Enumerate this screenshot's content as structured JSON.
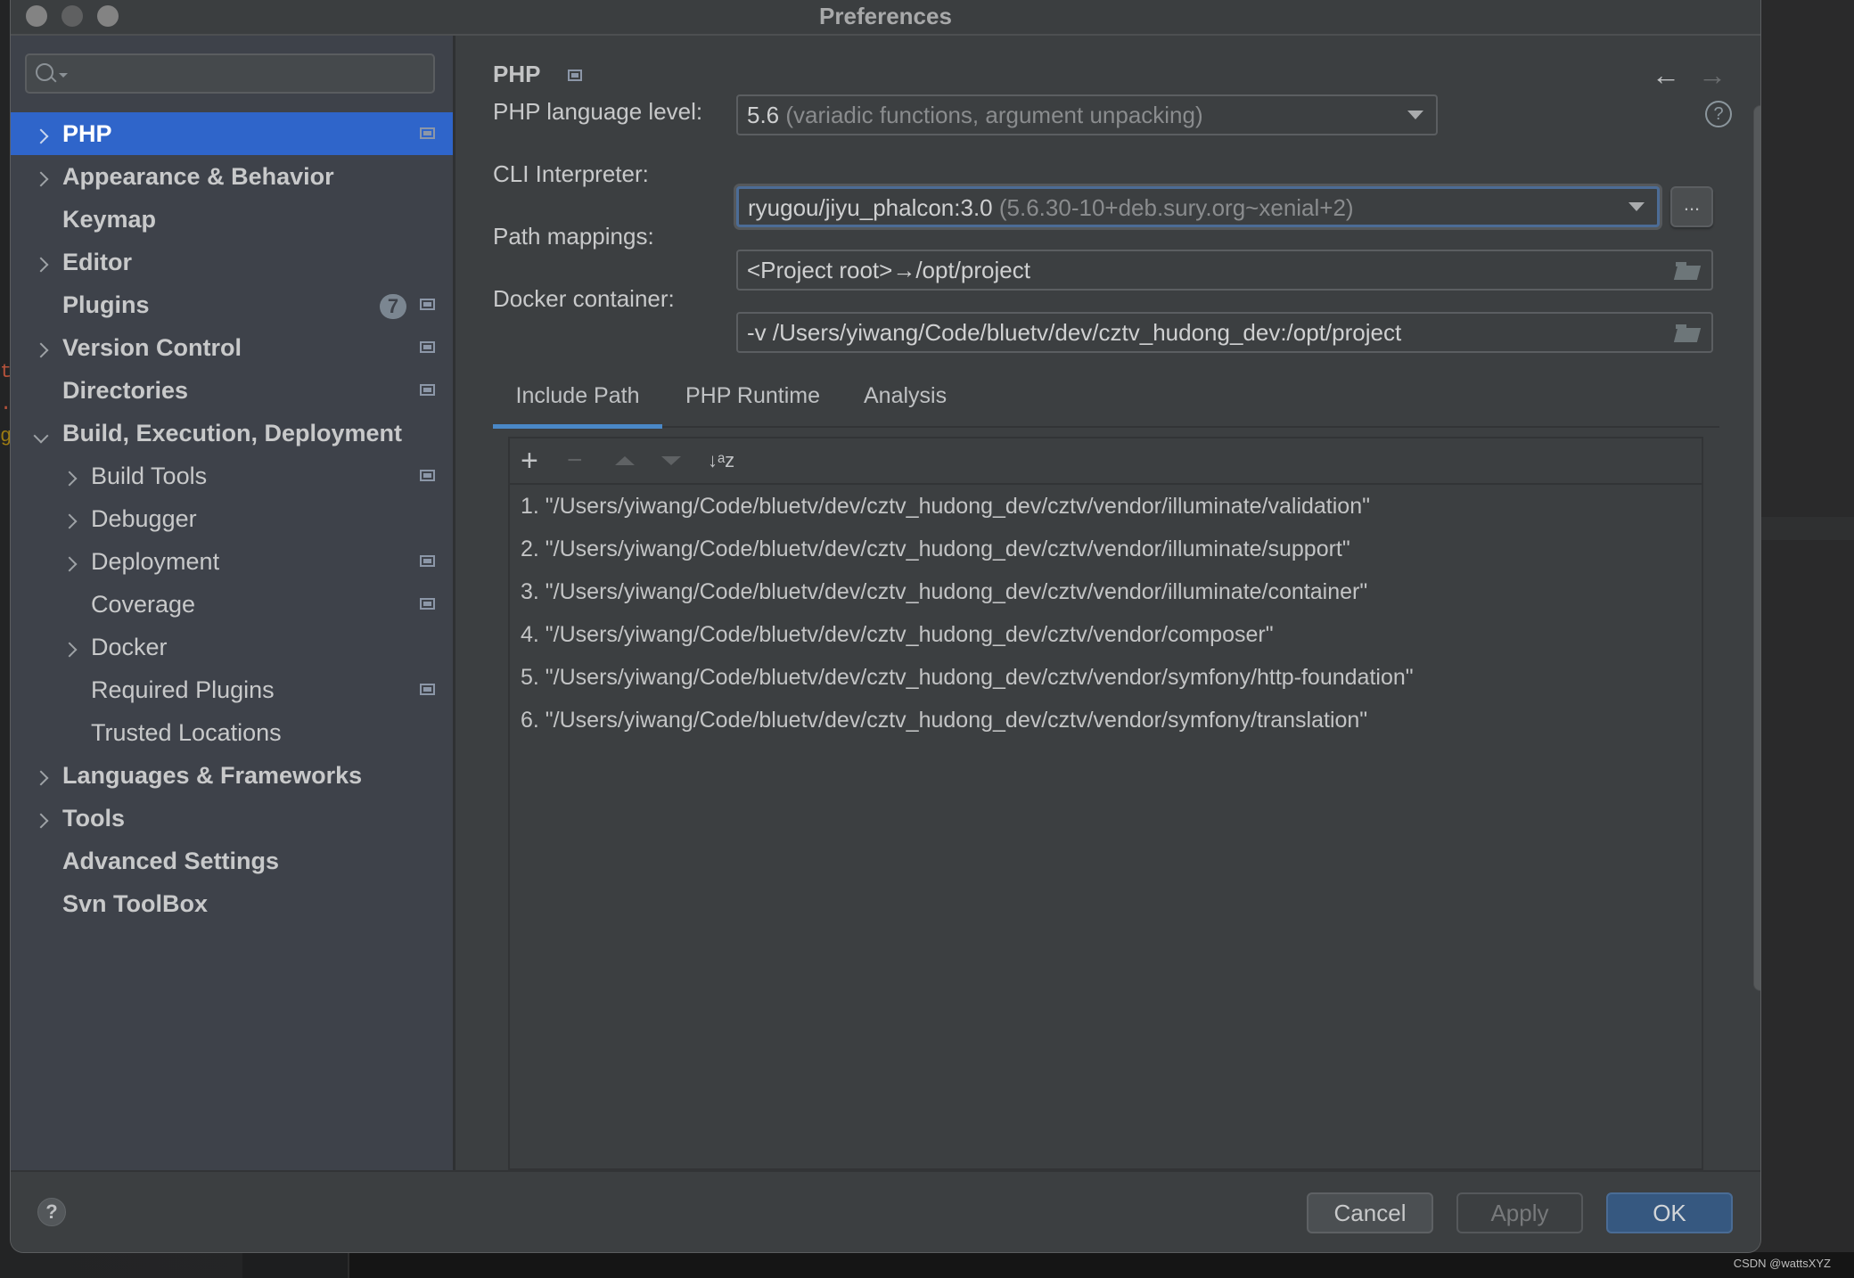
{
  "window": {
    "title": "Preferences"
  },
  "search": {
    "placeholder": "",
    "value": ""
  },
  "sidebar": {
    "items": [
      {
        "label": "PHP",
        "level": 0,
        "bold": true,
        "expander": "right",
        "selected": true,
        "project_icon": true
      },
      {
        "label": "Appearance & Behavior",
        "level": 0,
        "bold": true,
        "expander": "right"
      },
      {
        "label": "Keymap",
        "level": 0,
        "bold": true,
        "expander": "none"
      },
      {
        "label": "Editor",
        "level": 0,
        "bold": true,
        "expander": "right"
      },
      {
        "label": "Plugins",
        "level": 0,
        "bold": true,
        "expander": "none",
        "badge": "7",
        "project_icon": true
      },
      {
        "label": "Version Control",
        "level": 0,
        "bold": true,
        "expander": "right",
        "project_icon": true
      },
      {
        "label": "Directories",
        "level": 0,
        "bold": true,
        "expander": "none",
        "project_icon": true
      },
      {
        "label": "Build, Execution, Deployment",
        "level": 0,
        "bold": true,
        "expander": "down"
      },
      {
        "label": "Build Tools",
        "level": 1,
        "expander": "right",
        "project_icon": true
      },
      {
        "label": "Debugger",
        "level": 1,
        "expander": "right"
      },
      {
        "label": "Deployment",
        "level": 1,
        "expander": "right",
        "project_icon": true
      },
      {
        "label": "Coverage",
        "level": 1,
        "expander": "none",
        "project_icon": true
      },
      {
        "label": "Docker",
        "level": 1,
        "expander": "right"
      },
      {
        "label": "Required Plugins",
        "level": 1,
        "expander": "none",
        "project_icon": true
      },
      {
        "label": "Trusted Locations",
        "level": 1,
        "expander": "none"
      },
      {
        "label": "Languages & Frameworks",
        "level": 0,
        "bold": true,
        "expander": "right"
      },
      {
        "label": "Tools",
        "level": 0,
        "bold": true,
        "expander": "right"
      },
      {
        "label": "Advanced Settings",
        "level": 0,
        "bold": true,
        "expander": "none"
      },
      {
        "label": "Svn ToolBox",
        "level": 0,
        "bold": true,
        "expander": "none"
      }
    ]
  },
  "main": {
    "title": "PHP",
    "nav": {
      "back_icon": "←",
      "forward_icon": "→"
    },
    "fields": {
      "language_level": {
        "label": "PHP language level:",
        "value": "5.6",
        "hint": "(variadic functions, argument unpacking)"
      },
      "cli_interpreter": {
        "label": "CLI Interpreter:",
        "value": "ryugou/jiyu_phalcon:3.0",
        "hint": "(5.6.30-10+deb.sury.org~xenial+2)",
        "more_label": "..."
      },
      "path_mappings": {
        "label": "Path mappings:",
        "value": "<Project root>→/opt/project"
      },
      "docker_container": {
        "label": "Docker container:",
        "value": "-v /Users/yiwang/Code/bluetv/dev/cztv_hudong_dev:/opt/project"
      }
    },
    "help_icon": "?",
    "tabs": [
      {
        "label": "Include Path",
        "active": true
      },
      {
        "label": "PHP Runtime",
        "active": false
      },
      {
        "label": "Analysis",
        "active": false
      }
    ],
    "toolbar": {
      "add": "+",
      "remove": "−",
      "sort": "↓ᵃz"
    },
    "include_paths": [
      "1. \"/Users/yiwang/Code/bluetv/dev/cztv_hudong_dev/cztv/vendor/illuminate/validation\"",
      "2. \"/Users/yiwang/Code/bluetv/dev/cztv_hudong_dev/cztv/vendor/illuminate/support\"",
      "3. \"/Users/yiwang/Code/bluetv/dev/cztv_hudong_dev/cztv/vendor/illuminate/container\"",
      "4. \"/Users/yiwang/Code/bluetv/dev/cztv_hudong_dev/cztv/vendor/composer\"",
      "5. \"/Users/yiwang/Code/bluetv/dev/cztv_hudong_dev/cztv/vendor/symfony/http-foundation\"",
      "6. \"/Users/yiwang/Code/bluetv/dev/cztv_hudong_dev/cztv/vendor/symfony/translation\""
    ]
  },
  "footer": {
    "help": "?",
    "cancel": "Cancel",
    "apply": "Apply",
    "ok": "OK"
  },
  "watermark": "CSDN @wattsXYZ",
  "colors": {
    "selection": "#2f65ca",
    "ok_button": "#365880",
    "tab_underline": "#4a88c7",
    "focus_border": "#4c6c96"
  }
}
